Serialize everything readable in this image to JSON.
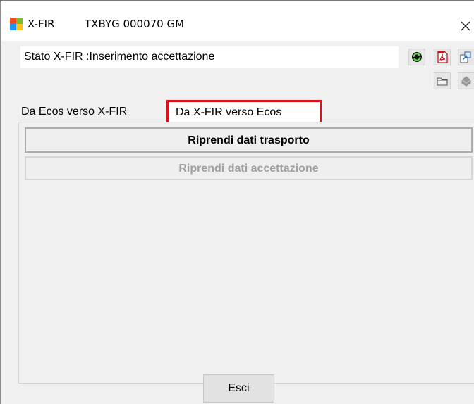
{
  "window": {
    "app_name": "X-FIR",
    "document_code": "TXBYG 000070 GM",
    "close_glyph": "×"
  },
  "status": {
    "label": "Stato X-FIR :",
    "value": "Inserimento accettazione"
  },
  "toolbar": {
    "icons": [
      "refresh-icon",
      "pdf-icon",
      "share-icon",
      "folder-icon",
      "disabled-shape-icon"
    ]
  },
  "tabs": [
    {
      "label": "Da Ecos verso X-FIR",
      "active": false
    },
    {
      "label": "Da X-FIR verso Ecos",
      "active": true
    }
  ],
  "actions": {
    "primary_label": "Riprendi dati trasporto",
    "disabled_label": "Riprendi dati accettazione"
  },
  "footer": {
    "exit_label": "Esci"
  },
  "colors": {
    "highlight_border": "#e0101a",
    "client_background": "#f0f0f0"
  }
}
